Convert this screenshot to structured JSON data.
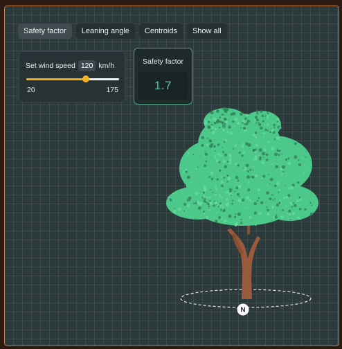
{
  "tabs": [
    {
      "label": "Safety factor",
      "active": true
    },
    {
      "label": "Leaning angle",
      "active": false
    },
    {
      "label": "Centroids",
      "active": false
    },
    {
      "label": "Show all",
      "active": false
    }
  ],
  "wind": {
    "label": "Set wind speed",
    "value": "120",
    "unit": "km/h",
    "min": "20",
    "max": "175",
    "level_fraction": 0.645
  },
  "safety_card": {
    "label": "Safety factor",
    "value": "1.7"
  },
  "scene": {
    "compass_label": "N"
  },
  "colors": {
    "accent": "#f4b21e",
    "foliage": "#4cc98a",
    "trunk": "#9a5a3c",
    "card_border": "#4ca07e",
    "value_text": "#5bc0a3"
  },
  "icons": [
    "compass-north-icon"
  ]
}
